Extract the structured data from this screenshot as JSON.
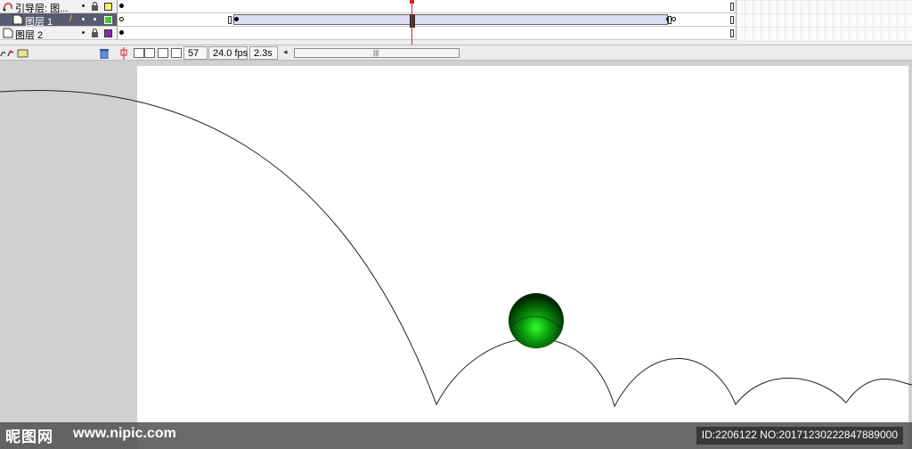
{
  "layers": [
    {
      "name": "引导层: 图...",
      "type": "guide",
      "selected": false,
      "outline_color": "#f5f06a"
    },
    {
      "name": "图层 1",
      "type": "normal",
      "selected": true,
      "outline_color": "#39d02a"
    },
    {
      "name": "图层 2",
      "type": "normal",
      "selected": false,
      "outline_color": "#8a2ab0"
    }
  ],
  "status": {
    "current_frame": "57",
    "frame_rate": "24.0 fps",
    "elapsed_time": "2.3s"
  },
  "icons": {
    "add_layer": "add-layer-icon",
    "add_guide": "add-motion-guide-icon",
    "add_folder": "add-folder-icon",
    "delete": "trash-icon",
    "center_frame": "center-frame-icon",
    "onion_skin": "onion-skin-icon",
    "onion_outline": "onion-skin-outlines-icon",
    "edit_multiple": "edit-multiple-frames-icon",
    "modify_markers": "modify-onion-markers-icon"
  },
  "colors": {
    "ball_highlight": "#2cff2c",
    "ball_dark": "#003300",
    "path": "#222222",
    "playhead": "#e02020"
  },
  "watermark": {
    "logo": "昵图网",
    "site": "www.nipic.com",
    "id_text": "ID:2206122 NO:20171230222847889000"
  }
}
